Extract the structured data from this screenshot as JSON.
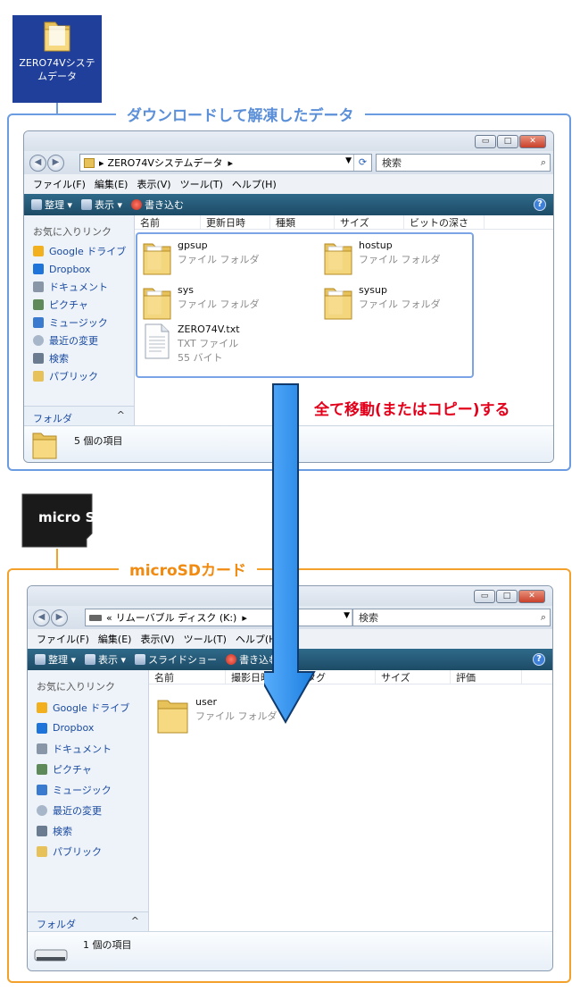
{
  "desktop_icon": {
    "label": "ZERO74Vシステムデータ"
  },
  "top_frame": {
    "label": "ダウンロードして解凍したデータ"
  },
  "bottom_frame": {
    "label": "microSDカード"
  },
  "annotation": {
    "move_label": "全て移動(またはコピー)する"
  },
  "sd_card_label": "micro SD",
  "window1": {
    "address": {
      "prefix": "▸",
      "path": "ZERO74Vシステムデータ",
      "suffix": "▸"
    },
    "search_placeholder": "検索",
    "menu": [
      "ファイル(F)",
      "編集(E)",
      "表示(V)",
      "ツール(T)",
      "ヘルプ(H)"
    ],
    "toolbar": {
      "organize": "整理 ▾",
      "views": "表示 ▾",
      "burn": "書き込む"
    },
    "sidebar": {
      "title": "お気に入りリンク",
      "items": [
        "Google ドライブ",
        "Dropbox",
        "ドキュメント",
        "ピクチャ",
        "ミュージック",
        "最近の変更",
        "検索",
        "パブリック"
      ],
      "folder_label": "フォルダ",
      "folder_chevron": "^"
    },
    "columns": [
      "名前",
      "更新日時",
      "種類",
      "サイズ",
      "ビットの深さ"
    ],
    "files": [
      {
        "name": "gpsup",
        "line2": "ファイル フォルダ",
        "line3": "",
        "icon": "folder-icon"
      },
      {
        "name": "hostup",
        "line2": "ファイル フォルダ",
        "line3": "",
        "icon": "folder-icon"
      },
      {
        "name": "sys",
        "line2": "ファイル フォルダ",
        "line3": "",
        "icon": "folder-icon"
      },
      {
        "name": "sysup",
        "line2": "ファイル フォルダ",
        "line3": "",
        "icon": "folder-icon"
      },
      {
        "name": "ZERO74V.txt",
        "line2": "TXT ファイル",
        "line3": "55 バイト",
        "icon": "text-file-icon"
      }
    ],
    "status": "5 個の項目"
  },
  "window2": {
    "address": {
      "prefix": "«",
      "path": "リムーバブル ディスク (K:)",
      "suffix": "▸"
    },
    "search_placeholder": "検索",
    "menu": [
      "ファイル(F)",
      "編集(E)",
      "表示(V)",
      "ツール(T)",
      "ヘルプ(H)"
    ],
    "toolbar": {
      "organize": "整理 ▾",
      "views": "表示 ▾",
      "slideshow": "スライドショー",
      "burn": "書き込む"
    },
    "sidebar": {
      "title": "お気に入りリンク",
      "items": [
        "Google ドライブ",
        "Dropbox",
        "ドキュメント",
        "ピクチャ",
        "ミュージック",
        "最近の変更",
        "検索",
        "パブリック"
      ],
      "folder_label": "フォルダ",
      "folder_chevron": "^"
    },
    "columns": [
      "名前",
      "撮影日時",
      "タグ",
      "サイズ",
      "評価"
    ],
    "files": [
      {
        "name": "user",
        "line2": "ファイル フォルダ",
        "icon": "folder-icon"
      }
    ],
    "status": "1 個の項目"
  },
  "colors": {
    "blue_frame": "#6b9be0",
    "orange_frame": "#f3a12a",
    "arrow": "#2a8fe8",
    "red_text": "#e2001a"
  }
}
